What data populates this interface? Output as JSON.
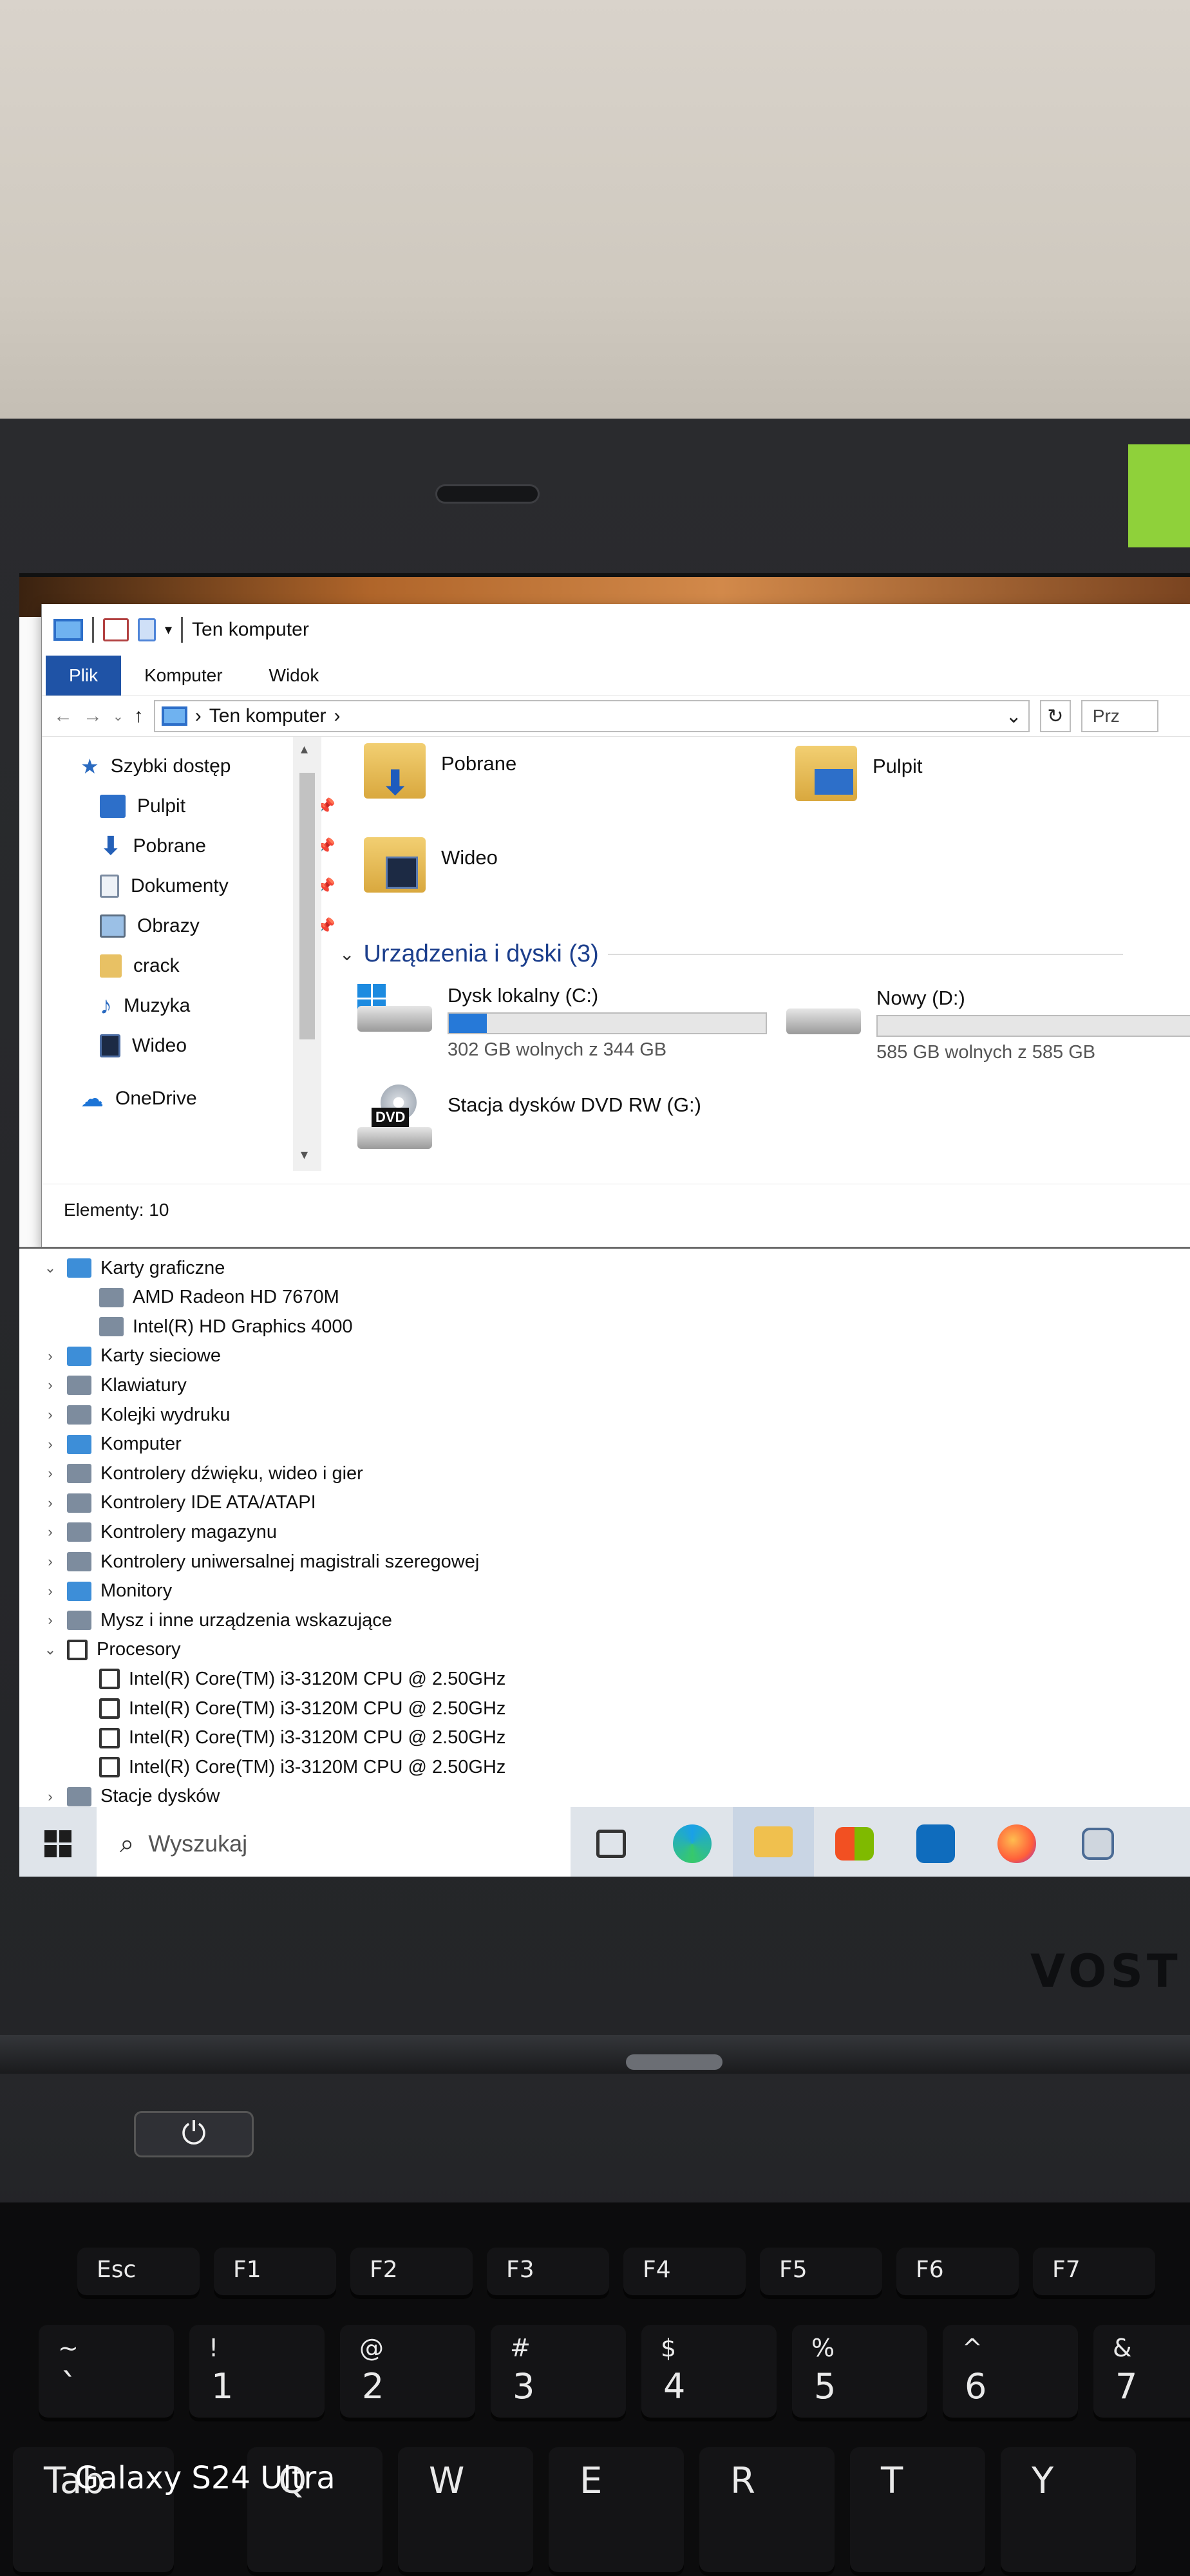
{
  "explorer": {
    "title": "Ten komputer",
    "ribbon_tabs": [
      "Plik",
      "Komputer",
      "Widok"
    ],
    "address_path": "Ten komputer",
    "search_placeholder": "Prz",
    "nav_pane": {
      "quick_access": "Szybki dostęp",
      "quick_items": [
        "Pulpit",
        "Pobrane",
        "Dokumenty",
        "Obrazy",
        "crack",
        "Muzyka",
        "Wideo"
      ],
      "onedrive": "OneDrive"
    },
    "folders": [
      "Pobrane",
      "Pulpit",
      "Wideo"
    ],
    "devices_group": "Urządzenia i dyski (3)",
    "drives": [
      {
        "name": "Dysk lokalny (C:)",
        "free_text": "302 GB wolnych z 344 GB",
        "used_fraction": 0.12
      },
      {
        "name": "Nowy (D:)",
        "free_text": "585 GB wolnych z 585 GB",
        "used_fraction": 0.0
      },
      {
        "name": "Stacja dysków DVD RW (G:)",
        "dvd_label": "DVD"
      }
    ],
    "status": "Elementy: 10"
  },
  "device_manager": {
    "items": [
      {
        "label": "Karty graficzne",
        "expanded": true
      },
      {
        "label": "AMD Radeon HD 7670M",
        "child": true
      },
      {
        "label": "Intel(R) HD Graphics 4000",
        "child": true
      },
      {
        "label": "Karty sieciowe"
      },
      {
        "label": "Klawiatury"
      },
      {
        "label": "Kolejki wydruku"
      },
      {
        "label": "Komputer"
      },
      {
        "label": "Kontrolery dźwięku, wideo i gier"
      },
      {
        "label": "Kontrolery IDE ATA/ATAPI"
      },
      {
        "label": "Kontrolery magazynu"
      },
      {
        "label": "Kontrolery uniwersalnej magistrali szeregowej"
      },
      {
        "label": "Monitory"
      },
      {
        "label": "Mysz i inne urządzenia wskazujące"
      },
      {
        "label": "Procesory",
        "expanded": true
      },
      {
        "label": "Intel(R) Core(TM) i3-3120M CPU @ 2.50GHz",
        "child": true
      },
      {
        "label": "Intel(R) Core(TM) i3-3120M CPU @ 2.50GHz",
        "child": true
      },
      {
        "label": "Intel(R) Core(TM) i3-3120M CPU @ 2.50GHz",
        "child": true
      },
      {
        "label": "Intel(R) Core(TM) i3-3120M CPU @ 2.50GHz",
        "child": true
      },
      {
        "label": "Stacje dysków"
      }
    ]
  },
  "taskbar": {
    "search_placeholder": "Wyszukaj",
    "apps": [
      "task-view",
      "edge",
      "file-explorer",
      "store",
      "outlook",
      "firefox",
      "device-manager"
    ]
  },
  "laptop": {
    "brand": "VOST",
    "keys_f": [
      "Esc",
      "F1",
      "F2",
      "F3",
      "F4",
      "F5",
      "F6",
      "F7"
    ],
    "keys_num_top": [
      "~",
      "!",
      "@",
      "#",
      "$",
      "%",
      "^",
      "&"
    ],
    "keys_num_bot": [
      "`",
      "1",
      "2",
      "3",
      "4",
      "5",
      "6",
      "7"
    ],
    "keys_letters": [
      "Tab",
      "Q",
      "W",
      "E",
      "R",
      "T",
      "Y"
    ]
  },
  "watermark": "Galaxy S24 Ultra",
  "colors": {
    "ribbon_active": "#1f53a6",
    "drive_bar": "#2679d8",
    "group_title": "#1b3e8c",
    "sticker": "#8fd13a"
  }
}
